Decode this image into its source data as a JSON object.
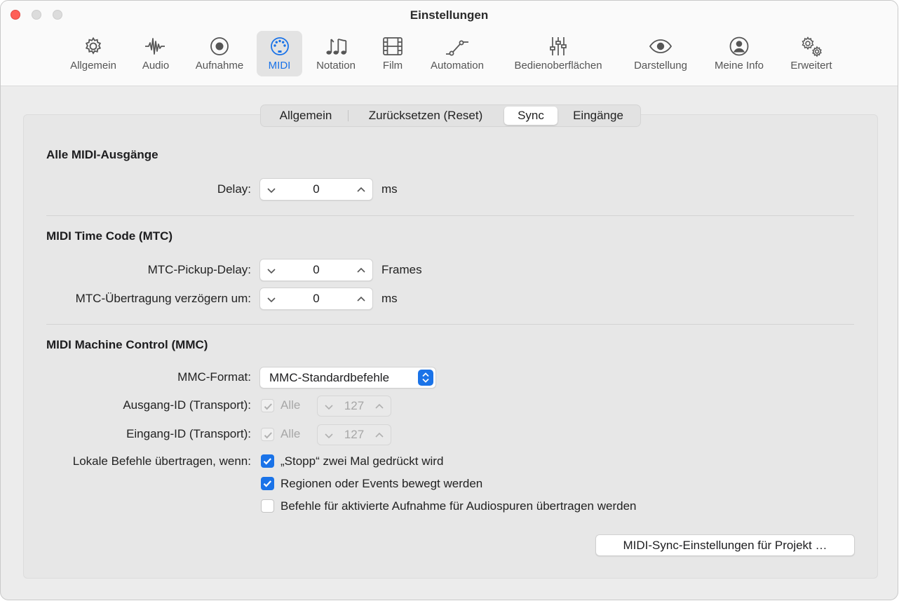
{
  "window": {
    "title": "Einstellungen"
  },
  "toolbar": {
    "items": [
      {
        "label": "Allgemein",
        "icon": "gear-icon"
      },
      {
        "label": "Audio",
        "icon": "waveform-icon"
      },
      {
        "label": "Aufnahme",
        "icon": "record-icon"
      },
      {
        "label": "MIDI",
        "icon": "midi-connector-icon",
        "active": true
      },
      {
        "label": "Notation",
        "icon": "music-notes-icon"
      },
      {
        "label": "Film",
        "icon": "film-icon"
      },
      {
        "label": "Automation",
        "icon": "automation-curve-icon"
      },
      {
        "label": "Bedienoberflächen",
        "icon": "faders-icon"
      },
      {
        "label": "Darstellung",
        "icon": "eye-icon"
      },
      {
        "label": "Meine Info",
        "icon": "person-icon"
      },
      {
        "label": "Erweitert",
        "icon": "gears-icon"
      }
    ]
  },
  "tabs": [
    {
      "label": "Allgemein"
    },
    {
      "label": "Zurücksetzen (Reset)"
    },
    {
      "label": "Sync",
      "active": true
    },
    {
      "label": "Eingänge"
    }
  ],
  "sections": {
    "outputs": {
      "title": "Alle MIDI-Ausgänge",
      "delay": {
        "label": "Delay:",
        "value": "0",
        "unit": "ms"
      }
    },
    "mtc": {
      "title": "MIDI Time Code (MTC)",
      "pickup": {
        "label": "MTC-Pickup-Delay:",
        "value": "0",
        "unit": "Frames"
      },
      "transmit": {
        "label": "MTC-Übertragung verzögern um:",
        "value": "0",
        "unit": "ms"
      }
    },
    "mmc": {
      "title": "MIDI Machine Control (MMC)",
      "format": {
        "label": "MMC-Format:",
        "value": "MMC-Standardbefehle"
      },
      "output_id": {
        "label": "Ausgang-ID (Transport):",
        "all_label": "Alle",
        "all_checked": true,
        "value": "127"
      },
      "input_id": {
        "label": "Eingang-ID (Transport):",
        "all_label": "Alle",
        "all_checked": true,
        "value": "127"
      },
      "local": {
        "label": "Lokale Befehle übertragen, wenn:",
        "options": [
          {
            "label": "„Stopp“ zwei Mal gedrückt wird",
            "checked": true
          },
          {
            "label": "Regionen oder Events bewegt werden",
            "checked": true
          },
          {
            "label": "Befehle für aktivierte Aufnahme für Audiospuren übertragen werden",
            "checked": false
          }
        ]
      },
      "project_button": "MIDI-Sync-Einstellungen für Projekt …"
    }
  },
  "colors": {
    "accent": "#1a73e8",
    "close": "#fe5f57"
  }
}
